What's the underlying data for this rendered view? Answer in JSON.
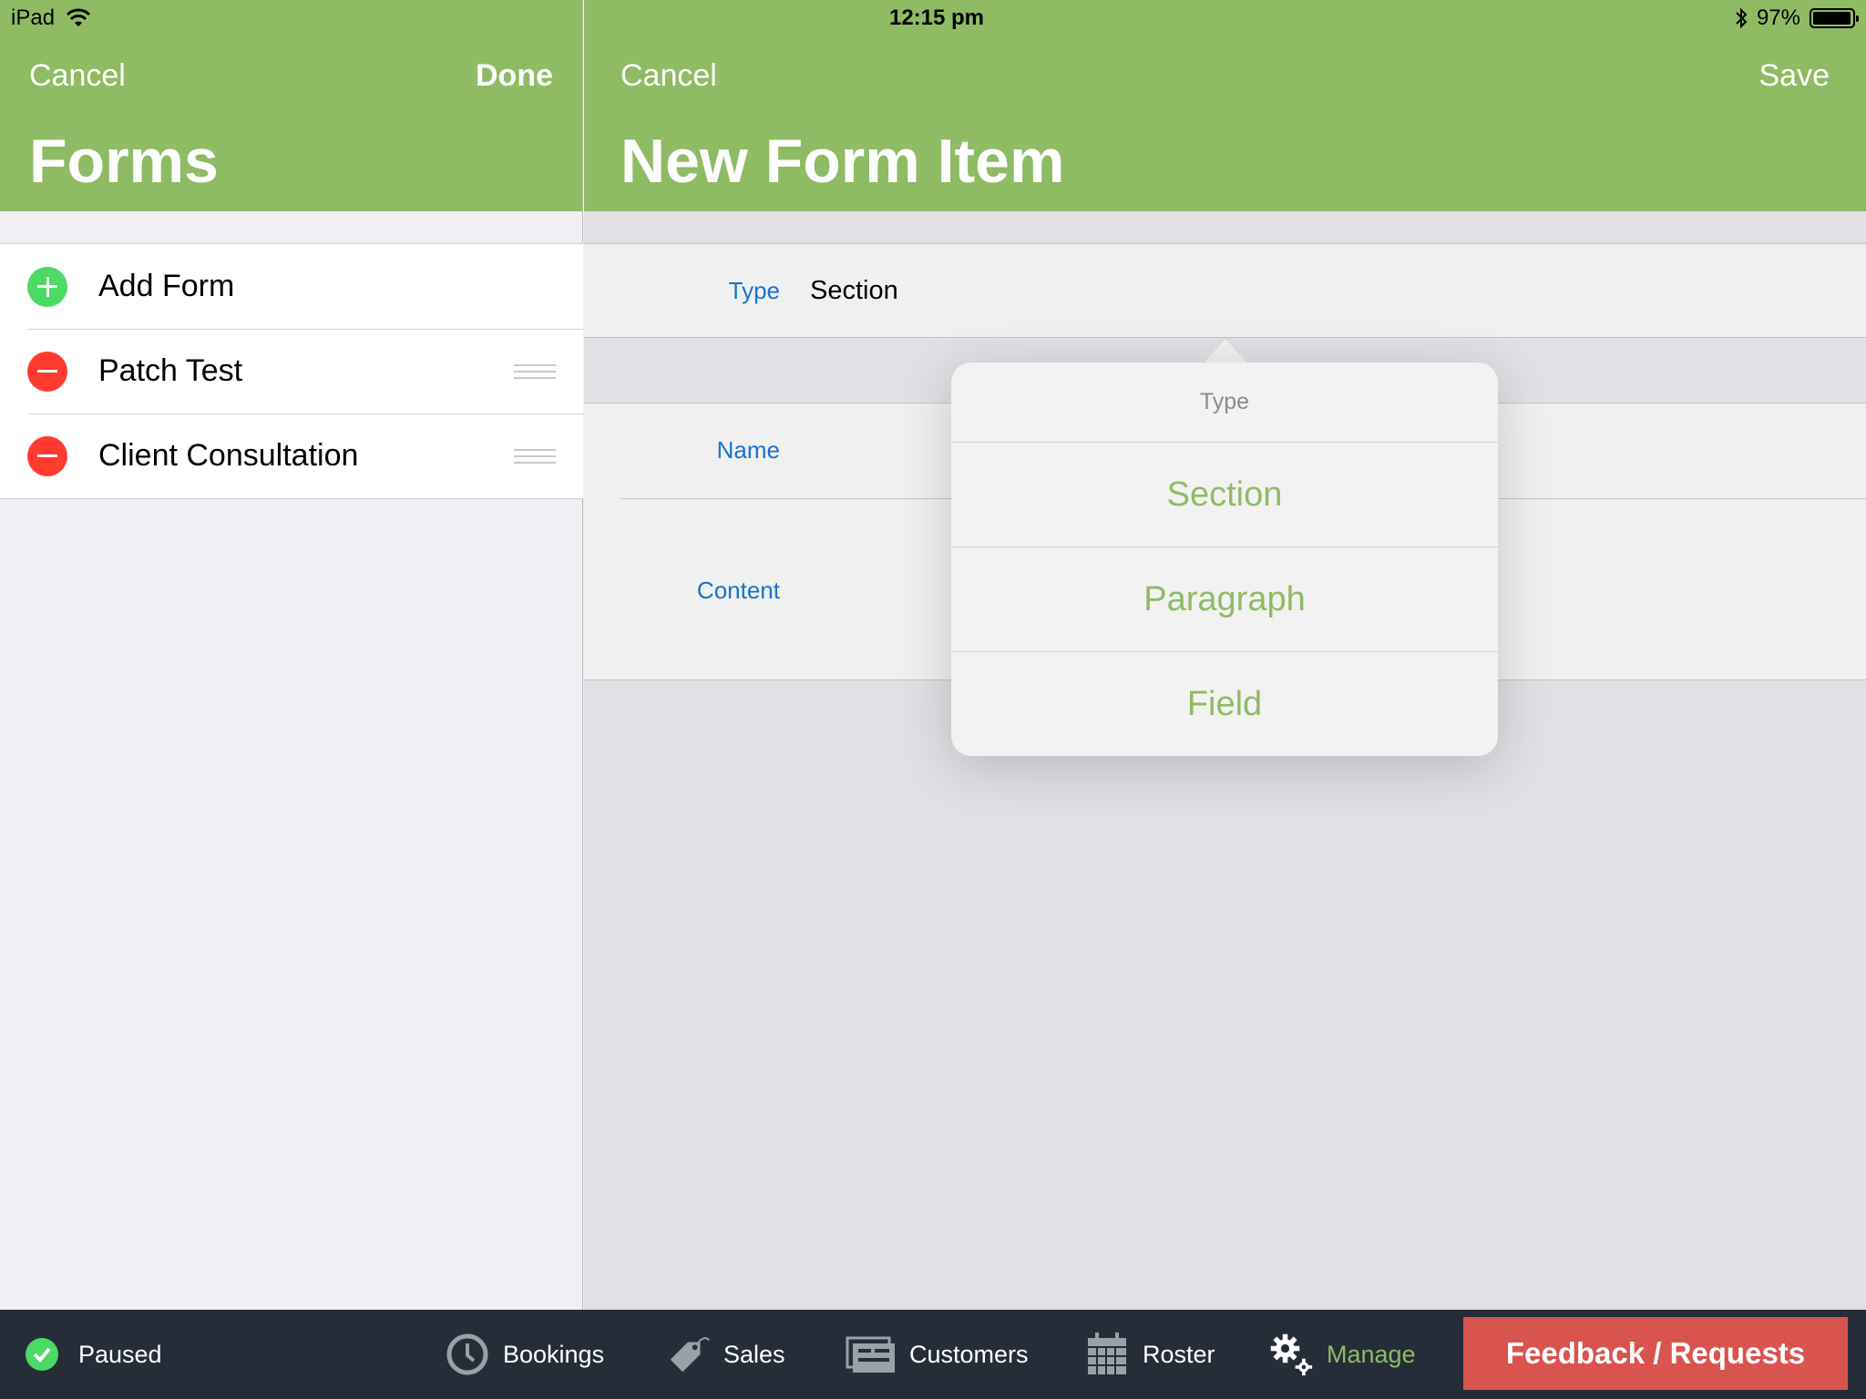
{
  "status_bar": {
    "device": "iPad",
    "time": "12:15 pm",
    "battery": "97%",
    "battery_level": 0.97
  },
  "left": {
    "cancel": "Cancel",
    "done": "Done",
    "title": "Forms",
    "items": [
      {
        "label": "Add Form",
        "kind": "add"
      },
      {
        "label": "Patch Test",
        "kind": "remove"
      },
      {
        "label": "Client Consultation",
        "kind": "remove"
      }
    ]
  },
  "right": {
    "cancel": "Cancel",
    "save": "Save",
    "title": "New Form Item",
    "type_label": "Type",
    "type_value": "Section",
    "name_label": "Name",
    "content_label": "Content"
  },
  "popover": {
    "title": "Type",
    "options": [
      "Section",
      "Paragraph",
      "Field"
    ]
  },
  "toolbar": {
    "status": "Paused",
    "tabs": [
      "Bookings",
      "Sales",
      "Customers",
      "Roster",
      "Manage"
    ],
    "active_tab": "Manage",
    "feedback": "Feedback / Requests"
  },
  "colors": {
    "brand_green": "#8fbb64",
    "toolbar_bg": "#252d38",
    "feedback_red": "#d9534f",
    "label_blue": "#1a7bd9"
  }
}
